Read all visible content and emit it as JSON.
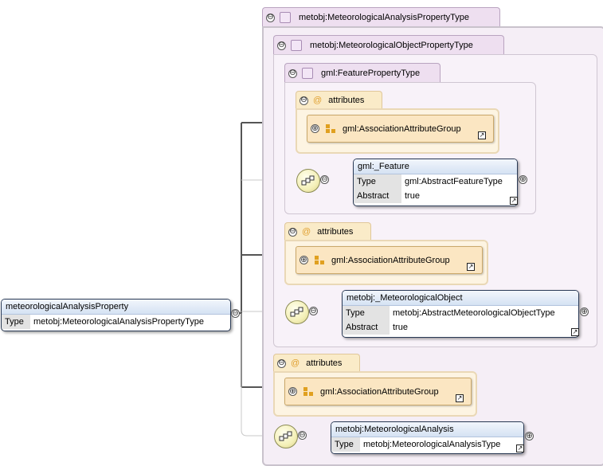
{
  "containers": {
    "analysis_type": {
      "name": "metobj:MeteorologicalAnalysisPropertyType"
    },
    "object_type": {
      "name": "metobj:MeteorologicalObjectPropertyType"
    },
    "feature_type": {
      "name": "gml:FeaturePropertyType"
    }
  },
  "attribute_groups": [
    {
      "tab": "attributes",
      "group": "gml:AssociationAttributeGroup"
    },
    {
      "tab": "attributes",
      "group": "gml:AssociationAttributeGroup"
    },
    {
      "tab": "attributes",
      "group": "gml:AssociationAttributeGroup"
    }
  ],
  "elements": {
    "root": {
      "title": "meteorologicalAnalysisProperty",
      "type_key": "Type",
      "type_value": "metobj:MeteorologicalAnalysisPropertyType"
    },
    "feature": {
      "title": "gml:_Feature",
      "type_key": "Type",
      "type_value": "gml:AbstractFeatureType",
      "abstract_key": "Abstract",
      "abstract_value": "true"
    },
    "met_object": {
      "title": "metobj:_MeteorologicalObject",
      "type_key": "Type",
      "type_value": "metobj:AbstractMeteorologicalObjectType",
      "abstract_key": "Abstract",
      "abstract_value": "true"
    },
    "met_analysis": {
      "title": "metobj:MeteorologicalAnalysis",
      "type_key": "Type",
      "type_value": "metobj:MeteorologicalAnalysisType"
    }
  },
  "symbols": {
    "collapse": "⊖",
    "expand": "⊕",
    "link": "↗"
  },
  "icons": [
    "square-type-icon",
    "at-sign-icon",
    "attribute-group-icon",
    "sequence-icon",
    "collapse-icon",
    "expand-icon",
    "link-arrow-icon"
  ],
  "colors": {
    "type_tab": "#eedff0",
    "attr_tab": "#faebc8",
    "element_header": "#d5e2f3",
    "connector": "#555555"
  }
}
